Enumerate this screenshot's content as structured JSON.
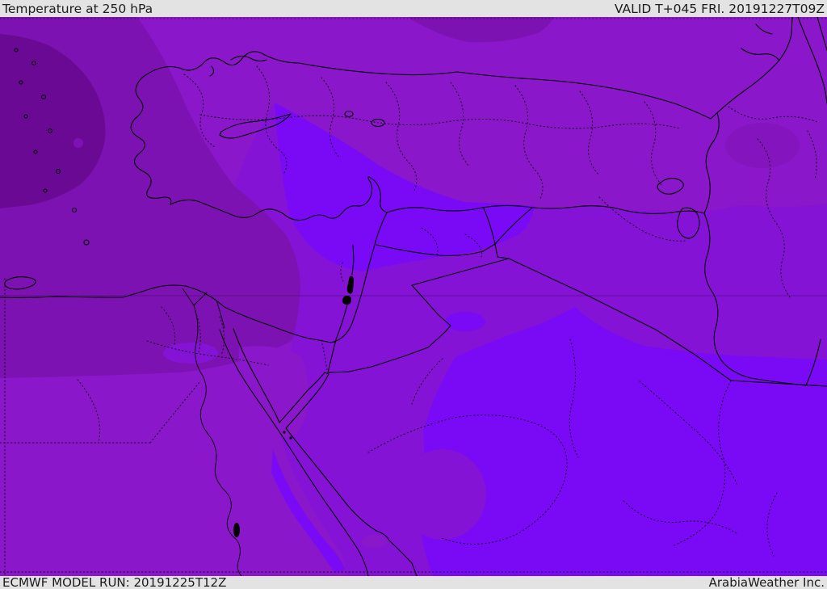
{
  "header": {
    "title": "Temperature at 250 hPa",
    "valid": "VALID T+045 FRI. 20191227T09Z"
  },
  "footer": {
    "model_run": "ECMWF MODEL RUN: 20191225T12Z",
    "provider": "ArabiaWeather Inc."
  },
  "map": {
    "parameter": "Temperature",
    "level": "250 hPa",
    "model": "ECMWF",
    "palette": {
      "p1": "#690994",
      "p2": "#7d12b2",
      "p3": "#8a17c9",
      "p4": "#8413d6",
      "p5": "#7a0af6",
      "bar_bg": "#e3e3e3",
      "bar_text": "#1c1c1c",
      "outline": "#000000"
    },
    "shading_levels": [
      {
        "name": "darkest-purple-coldest",
        "color": "#690994"
      },
      {
        "name": "dark-purple",
        "color": "#7d12b2"
      },
      {
        "name": "medium-purple",
        "color": "#8a17c9"
      },
      {
        "name": "bright-purple",
        "color": "#8413d6"
      },
      {
        "name": "brightest-violet",
        "color": "#7a0af6"
      }
    ]
  }
}
